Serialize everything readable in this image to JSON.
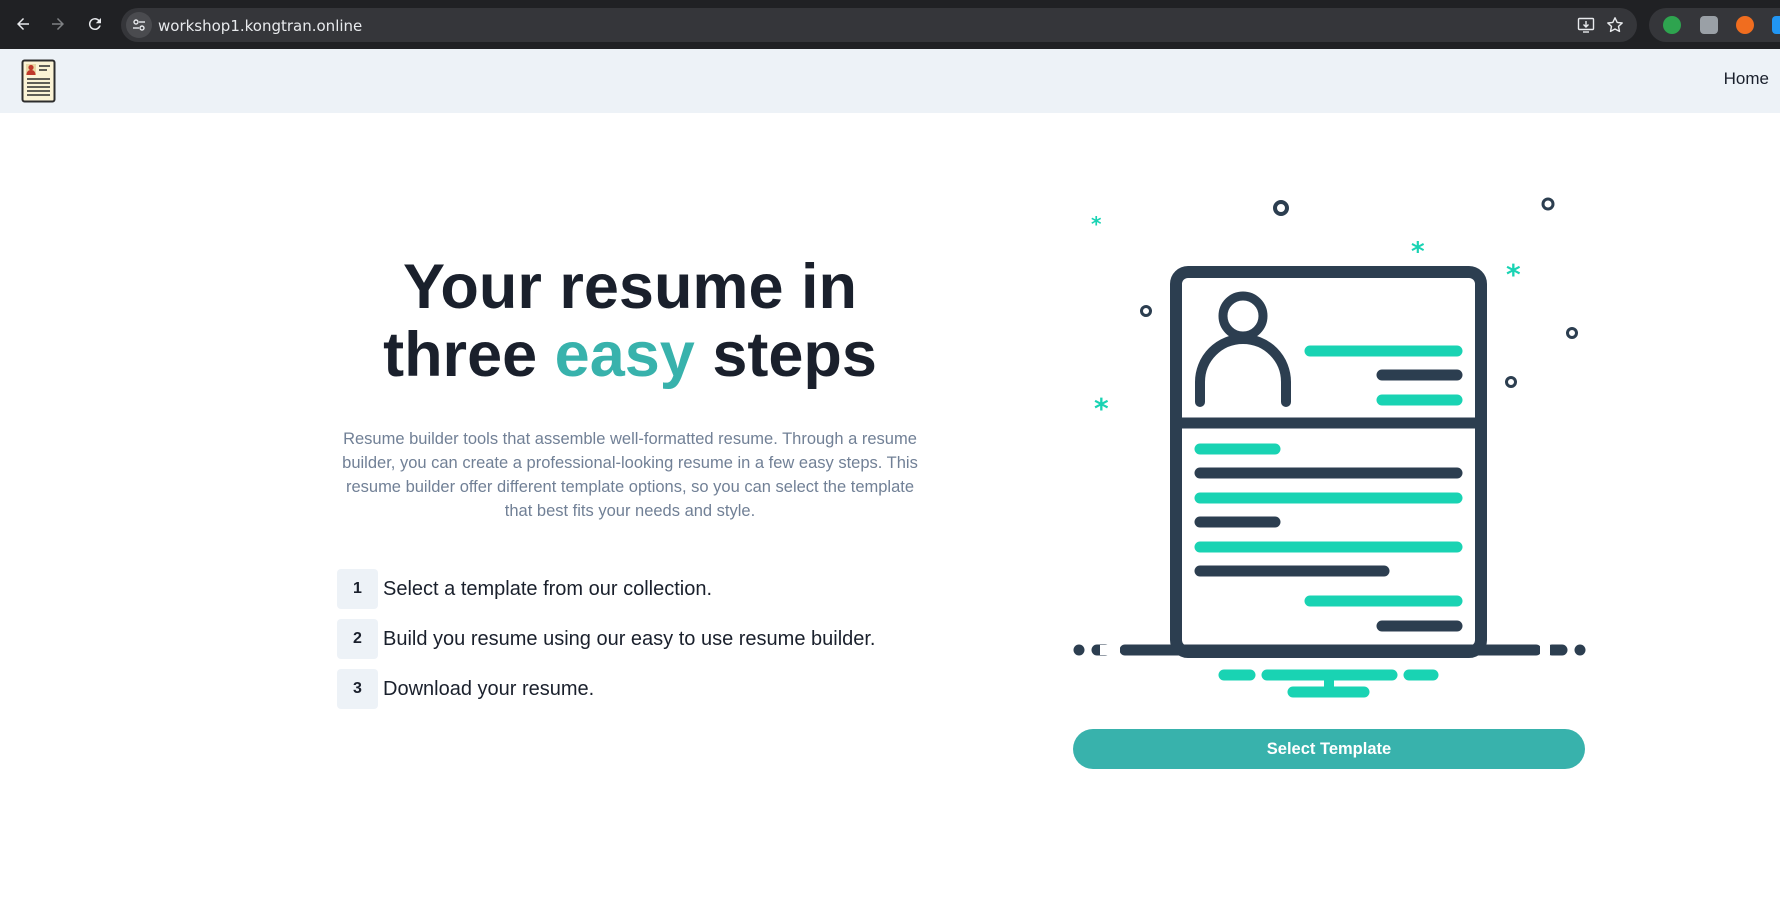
{
  "browser": {
    "url": "workshop1.kongtran.online"
  },
  "header": {
    "nav_home": "Home"
  },
  "hero": {
    "title_line1": "Your resume in",
    "title_line2_before": "three ",
    "title_line2_accent": "easy",
    "title_line2_after": " steps",
    "description": "Resume builder tools that assemble well-formatted resume. Through a resume builder, you can create a professional-looking resume in a few easy steps. This resume builder offer different template options, so you can select the template that best fits your needs and style.",
    "steps": [
      {
        "num": "1",
        "text": "Select a template from our collection."
      },
      {
        "num": "2",
        "text": "Build you resume using our easy to use resume builder."
      },
      {
        "num": "3",
        "text": "Download your resume."
      }
    ],
    "cta_label": "Select Template"
  },
  "colors": {
    "accent": "#38b2ac",
    "illustration_teal": "#19d3b3",
    "illustration_dark": "#2c3e50",
    "header_bg": "#edf2f7",
    "text_dark": "#1a202c",
    "text_muted": "#718096"
  },
  "icons": {
    "back": "back-arrow-icon",
    "forward": "forward-arrow-icon",
    "reload": "reload-icon",
    "site_info": "site-info-icon",
    "install": "install-app-icon",
    "bookmark": "star-icon",
    "logo": "resume-document-logo"
  }
}
